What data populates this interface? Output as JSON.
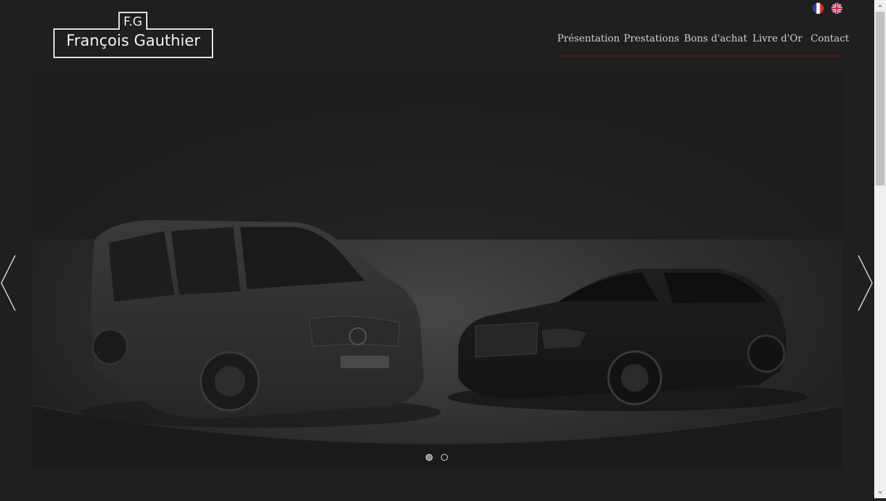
{
  "brand": {
    "monogram": "F.G",
    "name": "François Gauthier"
  },
  "languages": [
    {
      "code": "fr",
      "icon": "flag-fr-icon"
    },
    {
      "code": "en",
      "icon": "flag-uk-icon"
    }
  ],
  "nav": {
    "items": [
      "Présentation",
      "Prestations",
      "Bons d'achat",
      "Livre d'Or",
      "Contact"
    ],
    "underline_color": "#5c1414"
  },
  "slider": {
    "image": "mercedes-van-and-sedan",
    "slide_count": 2,
    "active_slide": 1,
    "prev_icon": "chevron-left-icon",
    "next_icon": "chevron-right-icon"
  },
  "colors": {
    "background": "#1f1f1f",
    "text": "#cfcfcf"
  }
}
